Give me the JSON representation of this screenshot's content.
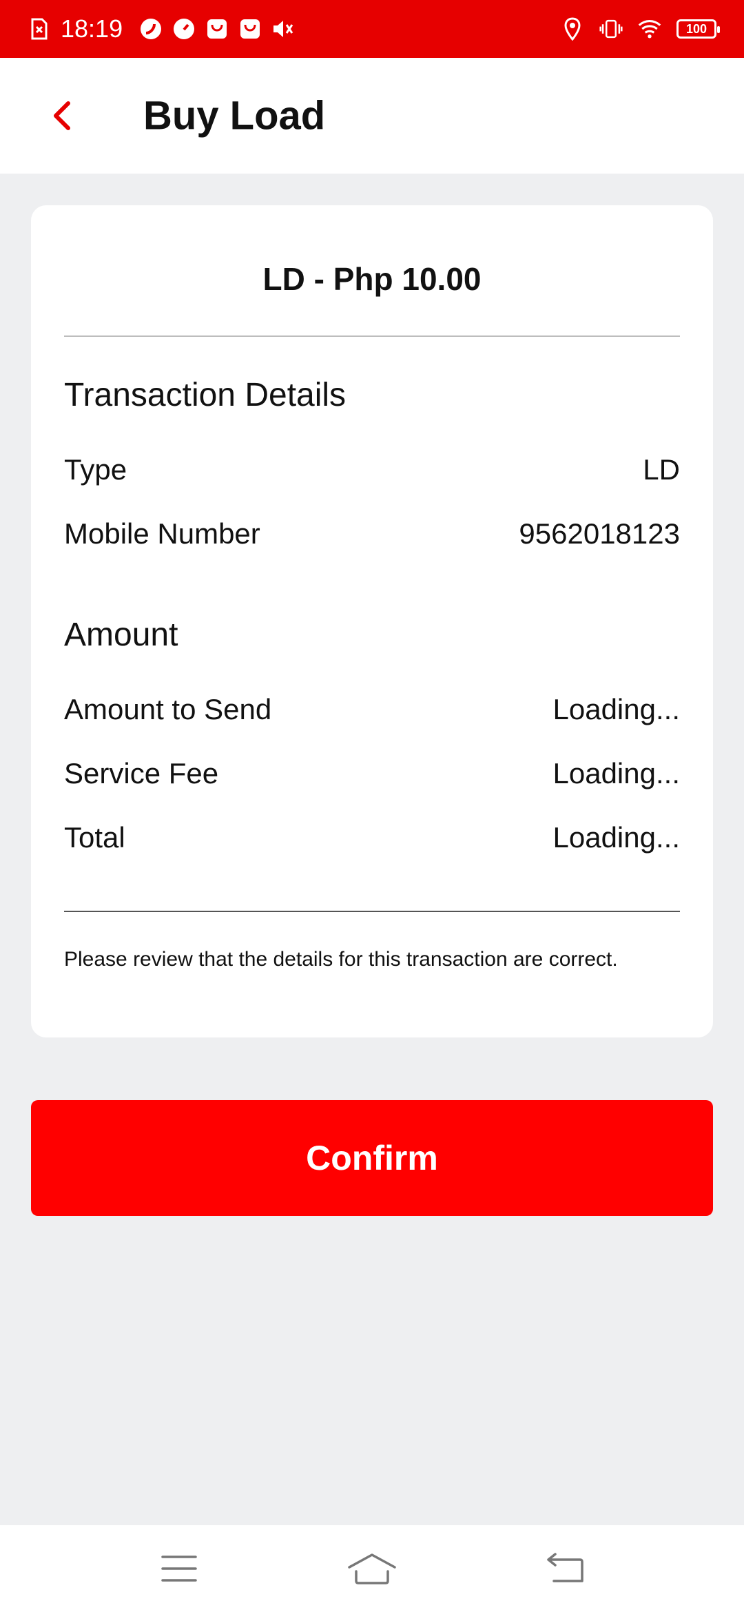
{
  "status_bar": {
    "time": "18:19",
    "battery": "100",
    "background_color": "#e60000"
  },
  "app_bar": {
    "title": "Buy Load",
    "back_icon": "chevron-left-icon"
  },
  "card": {
    "title": "LD - Php 10.00",
    "transaction_section": {
      "heading": "Transaction Details",
      "rows": [
        {
          "label": "Type",
          "value": "LD"
        },
        {
          "label": "Mobile Number",
          "value": "9562018123"
        }
      ]
    },
    "amount_section": {
      "heading": "Amount",
      "rows": [
        {
          "label": "Amount to Send",
          "value": "Loading..."
        },
        {
          "label": "Service Fee",
          "value": "Loading..."
        },
        {
          "label": "Total",
          "value": "Loading..."
        }
      ]
    },
    "note": "Please review that the details for this transaction are correct."
  },
  "confirm_button": {
    "label": "Confirm",
    "color": "#ff0000"
  },
  "nav_bar": {
    "items": [
      "menu-icon",
      "home-icon",
      "back-icon"
    ]
  }
}
